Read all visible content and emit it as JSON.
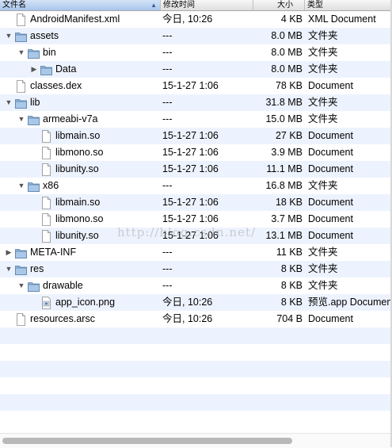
{
  "columns": {
    "name": "文件名",
    "date": "修改时间",
    "size": "大小",
    "kind": "类型"
  },
  "rows": [
    {
      "depth": 0,
      "disclosure": "none",
      "icon": "document-icon",
      "name": "AndroidManifest.xml",
      "date": "今日, 10:26",
      "size": "4 KB",
      "kind": "XML Document"
    },
    {
      "depth": 0,
      "disclosure": "expanded",
      "icon": "folder-icon",
      "name": "assets",
      "date": "---",
      "size": "8.0 MB",
      "kind": "文件夹"
    },
    {
      "depth": 1,
      "disclosure": "expanded",
      "icon": "folder-icon",
      "name": "bin",
      "date": "---",
      "size": "8.0 MB",
      "kind": "文件夹"
    },
    {
      "depth": 2,
      "disclosure": "collapsed",
      "icon": "folder-icon",
      "name": "Data",
      "date": "---",
      "size": "8.0 MB",
      "kind": "文件夹"
    },
    {
      "depth": 0,
      "disclosure": "none",
      "icon": "document-icon",
      "name": "classes.dex",
      "date": "15-1-27 1:06",
      "size": "78 KB",
      "kind": "Document"
    },
    {
      "depth": 0,
      "disclosure": "expanded",
      "icon": "folder-icon",
      "name": "lib",
      "date": "---",
      "size": "31.8 MB",
      "kind": "文件夹"
    },
    {
      "depth": 1,
      "disclosure": "expanded",
      "icon": "folder-icon",
      "name": "armeabi-v7a",
      "date": "---",
      "size": "15.0 MB",
      "kind": "文件夹"
    },
    {
      "depth": 2,
      "disclosure": "none",
      "icon": "document-icon",
      "name": "libmain.so",
      "date": "15-1-27 1:06",
      "size": "27 KB",
      "kind": "Document"
    },
    {
      "depth": 2,
      "disclosure": "none",
      "icon": "document-icon",
      "name": "libmono.so",
      "date": "15-1-27 1:06",
      "size": "3.9 MB",
      "kind": "Document"
    },
    {
      "depth": 2,
      "disclosure": "none",
      "icon": "document-icon",
      "name": "libunity.so",
      "date": "15-1-27 1:06",
      "size": "11.1 MB",
      "kind": "Document"
    },
    {
      "depth": 1,
      "disclosure": "expanded",
      "icon": "folder-icon",
      "name": "x86",
      "date": "---",
      "size": "16.8 MB",
      "kind": "文件夹"
    },
    {
      "depth": 2,
      "disclosure": "none",
      "icon": "document-icon",
      "name": "libmain.so",
      "date": "15-1-27 1:06",
      "size": "18 KB",
      "kind": "Document"
    },
    {
      "depth": 2,
      "disclosure": "none",
      "icon": "document-icon",
      "name": "libmono.so",
      "date": "15-1-27 1:06",
      "size": "3.7 MB",
      "kind": "Document"
    },
    {
      "depth": 2,
      "disclosure": "none",
      "icon": "document-icon",
      "name": "libunity.so",
      "date": "15-1-27 1:06",
      "size": "13.1 MB",
      "kind": "Document"
    },
    {
      "depth": 0,
      "disclosure": "collapsed",
      "icon": "folder-icon",
      "name": "META-INF",
      "date": "---",
      "size": "11 KB",
      "kind": "文件夹"
    },
    {
      "depth": 0,
      "disclosure": "expanded",
      "icon": "folder-icon",
      "name": "res",
      "date": "---",
      "size": "8 KB",
      "kind": "文件夹"
    },
    {
      "depth": 1,
      "disclosure": "expanded",
      "icon": "folder-icon",
      "name": "drawable",
      "date": "---",
      "size": "8 KB",
      "kind": "文件夹"
    },
    {
      "depth": 2,
      "disclosure": "none",
      "icon": "image-icon",
      "name": "app_icon.png",
      "date": "今日, 10:26",
      "size": "8 KB",
      "kind": "预览.app Document"
    },
    {
      "depth": 0,
      "disclosure": "none",
      "icon": "document-icon",
      "name": "resources.arsc",
      "date": "今日, 10:26",
      "size": "704 B",
      "kind": "Document"
    }
  ],
  "watermark": "http://blog.csdn.net/",
  "scrollbar": {
    "visible_fraction": 0.74
  }
}
